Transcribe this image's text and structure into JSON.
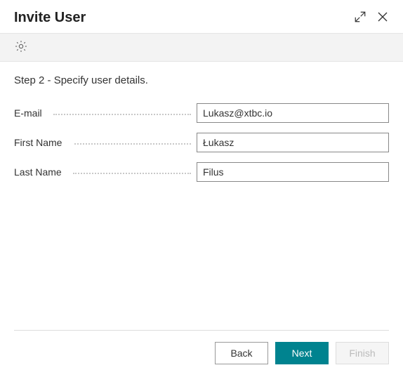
{
  "header": {
    "title": "Invite User"
  },
  "step": {
    "text": "Step 2 - Specify user details."
  },
  "form": {
    "email": {
      "label": "E-mail",
      "value": "Lukasz@xtbc.io"
    },
    "first_name": {
      "label": "First Name",
      "value": "Łukasz"
    },
    "last_name": {
      "label": "Last Name",
      "value": "Filus"
    }
  },
  "buttons": {
    "back": "Back",
    "next": "Next",
    "finish": "Finish"
  }
}
